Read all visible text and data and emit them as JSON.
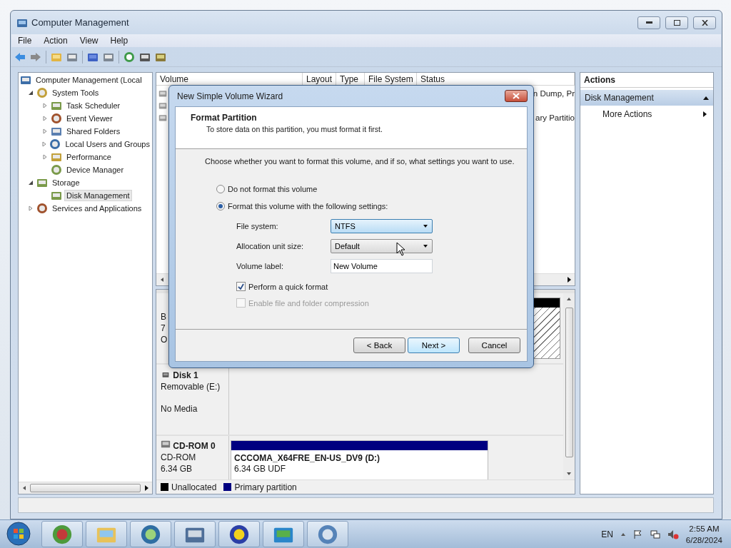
{
  "window": {
    "title": "Computer Management"
  },
  "menu": [
    "File",
    "Action",
    "View",
    "Help"
  ],
  "tree": [
    {
      "label": "Computer Management (Local",
      "selected": false,
      "children": [
        {
          "label": "System Tools",
          "selected": false,
          "expanded": true,
          "children": [
            {
              "label": "Task Scheduler",
              "selected": false,
              "expanded": false
            },
            {
              "label": "Event Viewer",
              "selected": false,
              "expanded": false
            },
            {
              "label": "Shared Folders",
              "selected": false,
              "expanded": false
            },
            {
              "label": "Local Users and Groups",
              "selected": false,
              "expanded": false
            },
            {
              "label": "Performance",
              "selected": false,
              "expanded": false
            },
            {
              "label": "Device Manager",
              "selected": false
            }
          ]
        },
        {
          "label": "Storage",
          "selected": false,
          "expanded": true,
          "children": [
            {
              "label": "Disk Management",
              "selected": true
            }
          ]
        },
        {
          "label": "Services and Applications",
          "selected": false,
          "expanded": false
        }
      ]
    }
  ],
  "volume_list": {
    "columns": [
      "Volume",
      "Layout",
      "Type",
      "File System",
      "Status"
    ],
    "rows": [
      {
        "status": "n Dump, Pr"
      },
      {
        "status": null
      },
      {
        "status": "ary Partitio"
      }
    ]
  },
  "disks": [
    {
      "kind": "basic",
      "lines": [
        "B",
        "7",
        "O"
      ]
    },
    {
      "kind": "removable",
      "name": "Disk 1",
      "lines": [
        "Removable (E:)",
        "No Media"
      ]
    },
    {
      "kind": "cdrom",
      "name": "CD-ROM 0",
      "lines": [
        "CD-ROM",
        "6.34 GB"
      ],
      "partition": {
        "name": "CCCOMA_X64FRE_EN-US_DV9  (D:)",
        "size": "6.34 GB UDF"
      }
    }
  ],
  "legend": [
    {
      "label": "Unallocated",
      "color": "#000000"
    },
    {
      "label": "Primary partition",
      "color": "#000080"
    }
  ],
  "actions": {
    "title": "Actions",
    "sections": [
      {
        "label": "Disk Management",
        "expanded": true,
        "items": [
          "More Actions"
        ]
      }
    ]
  },
  "dialog": {
    "title": "New Simple Volume Wizard",
    "heading": "Format Partition",
    "subheading": "To store data on this partition, you must format it first.",
    "prompt": "Choose whether you want to format this volume, and if so, what settings you want to use.",
    "options": [
      {
        "label": "Do not format this volume",
        "selected": false
      },
      {
        "label": "Format this volume with the following settings:",
        "selected": true
      }
    ],
    "fields": [
      {
        "kind": "dropdown",
        "label": "File system:",
        "value": "NTFS",
        "focused": true
      },
      {
        "kind": "dropdown",
        "label": "Allocation unit size:",
        "value": "Default",
        "focused": false
      },
      {
        "kind": "text",
        "label": "Volume label:",
        "value": "New Volume"
      }
    ],
    "checkboxes": [
      {
        "label": "Perform a quick format",
        "checked": true,
        "disabled": false
      },
      {
        "label": "Enable file and folder compression",
        "checked": false,
        "disabled": true
      }
    ],
    "buttons": [
      {
        "label": "< Back",
        "default": false
      },
      {
        "label": "Next >",
        "default": true
      },
      {
        "label": "Cancel",
        "default": false
      }
    ]
  },
  "taskbar": {
    "language": "EN",
    "time": "2:55 AM",
    "date": "6/28/2024"
  }
}
